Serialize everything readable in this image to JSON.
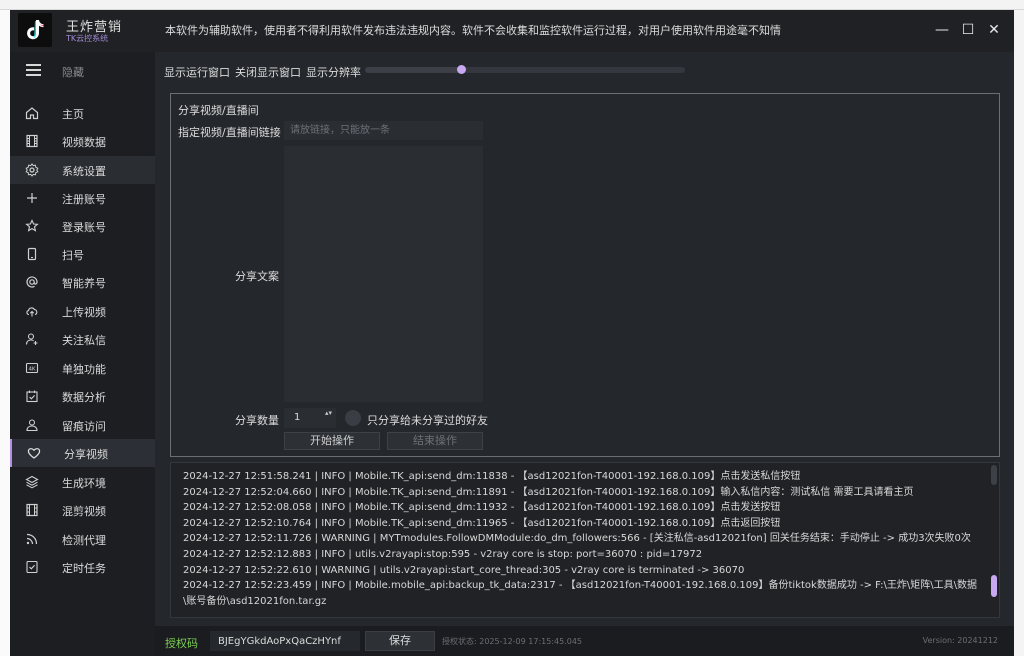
{
  "app": {
    "name": "王炸营销",
    "subtitle": "TK云控系统",
    "notice": "本软件为辅助软件，使用者不得利用软件发布违法违规内容。软件不会收集和监控软件运行过程，对用户使用软件用途毫不知情"
  },
  "window": {
    "minimize": "—",
    "maximize": "☐",
    "close": "✕"
  },
  "sidebar": {
    "hide_label": "隐藏",
    "items": [
      {
        "label": "主页",
        "icon": "home-icon"
      },
      {
        "label": "视频数据",
        "icon": "film-icon"
      },
      {
        "label": "系统设置",
        "icon": "gear-icon"
      },
      {
        "label": "注册账号",
        "icon": "plus-icon"
      },
      {
        "label": "登录账号",
        "icon": "star-icon"
      },
      {
        "label": "扫号",
        "icon": "phone-icon"
      },
      {
        "label": "智能养号",
        "icon": "at-icon"
      },
      {
        "label": "上传视频",
        "icon": "cloud-upload-icon"
      },
      {
        "label": "关注私信",
        "icon": "user-follow-icon"
      },
      {
        "label": "单独功能",
        "icon": "4k-icon"
      },
      {
        "label": "数据分析",
        "icon": "calendar-check-icon"
      },
      {
        "label": "留痕访问",
        "icon": "users-icon"
      },
      {
        "label": "分享视频",
        "icon": "heart-icon"
      },
      {
        "label": "生成环境",
        "icon": "layers-icon"
      },
      {
        "label": "混剪视频",
        "icon": "film-edit-icon"
      },
      {
        "label": "检测代理",
        "icon": "rss-icon"
      },
      {
        "label": "定时任务",
        "icon": "task-check-icon"
      }
    ]
  },
  "toolbar": {
    "show_run_window": "显示运行窗口",
    "close_display_window": "关闭显示窗口",
    "show_resolution": "显示分辨率",
    "resolution_level": 0.3
  },
  "share_panel": {
    "title": "分享视频/直播间",
    "link_label": "指定视频/直播间链接",
    "link_placeholder": "请放链接，只能放一条",
    "link_value": "",
    "copy_label": "分享文案",
    "copy_value": "",
    "count_label": "分享数量",
    "count_value": "1",
    "count_arrows": "▴▾",
    "only_unshared_label": "只分享给未分享过的好友",
    "start_button": "开始操作",
    "stop_button": "结束操作"
  },
  "log": {
    "lines": [
      "2024-12-27 12:51:58.241 | INFO     | Mobile.TK_api:send_dm:11838 - 【asd12021fon-T40001-192.168.0.109】点击发送私信按钮",
      "2024-12-27 12:52:04.660 | INFO     | Mobile.TK_api:send_dm:11891 - 【asd12021fon-T40001-192.168.0.109】输入私信内容：测试私信 需要工具请看主页",
      "2024-12-27 12:52:08.058 | INFO     | Mobile.TK_api:send_dm:11932 - 【asd12021fon-T40001-192.168.0.109】点击发送按钮",
      "2024-12-27 12:52:10.764 | INFO     | Mobile.TK_api:send_dm:11965 - 【asd12021fon-T40001-192.168.0.109】点击返回按钮",
      "2024-12-27 12:52:11.726 | WARNING  | MYTmodules.FollowDMModule:do_dm_followers:566 - [关注私信-asd12021fon] 回关任务结束：手动停止 -> 成功3次失败0次",
      "2024-12-27 12:52:12.883 | INFO     | utils.v2rayapi:stop:595 - v2ray core is stop: port=36070 : pid=17972",
      "2024-12-27 12:52:22.610 | WARNING  | utils.v2rayapi:start_core_thread:305 - v2ray core is terminated -> 36070",
      "2024-12-27 12:52:23.459 | INFO     | Mobile.mobile_api:backup_tk_data:2317 - 【asd12021fon-T40001-192.168.0.109】备份tiktok数据成功 -> F:\\王炸\\矩阵\\工具\\数据\\账号备份\\asd12021fon.tar.gz"
    ]
  },
  "status_bar": {
    "auth_label": "授权码",
    "auth_code": "BJEgYGkdAoPxQaCzHYnf",
    "save_button": "保存",
    "auth_status": "授权状态: 2025-12-09 17:15:45.045",
    "version": "Version: 20241212"
  },
  "colors": {
    "accent": "#c9a8f2",
    "auth_green": "#7ccf55",
    "background": "#24272b"
  }
}
